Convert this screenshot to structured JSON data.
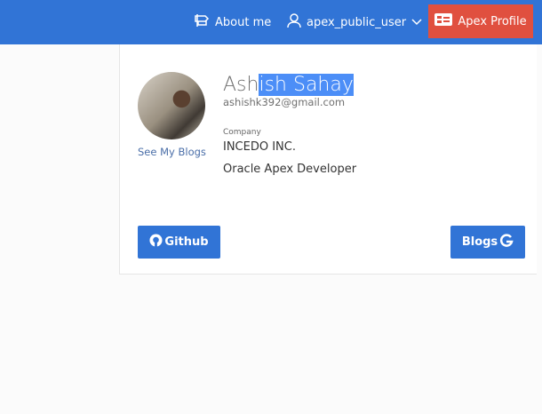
{
  "nav": {
    "about_label": "About me",
    "user_label": "apex_public_user",
    "profile_label": "Apex Profile"
  },
  "profile": {
    "name_plain": "Ash",
    "name_selected": "ish Sahay",
    "email": "ashishk392@gmail.com",
    "see_blogs": "See My Blogs",
    "company_label": "Company",
    "company": "INCEDO INC.",
    "role": "Oracle Apex Developer"
  },
  "buttons": {
    "github": "Github",
    "blogs": "Blogs"
  },
  "colors": {
    "header": "#3174d6",
    "profile_button": "#e0503f",
    "button": "#3174d6"
  }
}
